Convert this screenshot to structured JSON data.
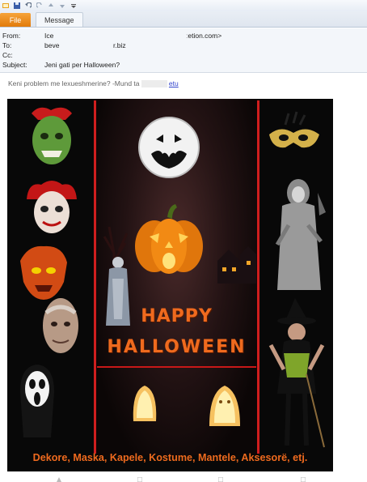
{
  "ribbon": {
    "tabs": [
      {
        "label": "File"
      },
      {
        "label": "Message"
      }
    ]
  },
  "header": {
    "from_label": "From:",
    "from_value": "Ice",
    "from_value_end": "ːetion.com>",
    "to_label": "To:",
    "to_value": "beve",
    "to_value_end": "r.biz",
    "cc_label": "Cc:",
    "subject_label": "Subject:",
    "subject_value": "Jeni gati per Halloween?"
  },
  "body": {
    "intro_text": "Keni problem me lexueshmerine? -Mund ta",
    "intro_link": "etu"
  },
  "poster": {
    "happy": "HAPPY",
    "halloween": "HALLOWEEN",
    "tagline": "Dekore, Maska, Kapele, Kostume, Mantele, Aksesorë, etj.",
    "colors": {
      "background": "#080808",
      "border_lines": "#d01e1e",
      "title_orange": "#ef6a1e"
    },
    "illustrations": [
      "green-zombie-mask",
      "red-jester-mask",
      "orange-monster-mask",
      "old-man-mask",
      "scream-mask",
      "venetian-mask",
      "grim-reaper-costume",
      "witch-costume",
      "full-moon-bat",
      "jack-o-lantern",
      "ghost-bride",
      "haunted-house",
      "glowing-ghost-lanterns"
    ]
  }
}
